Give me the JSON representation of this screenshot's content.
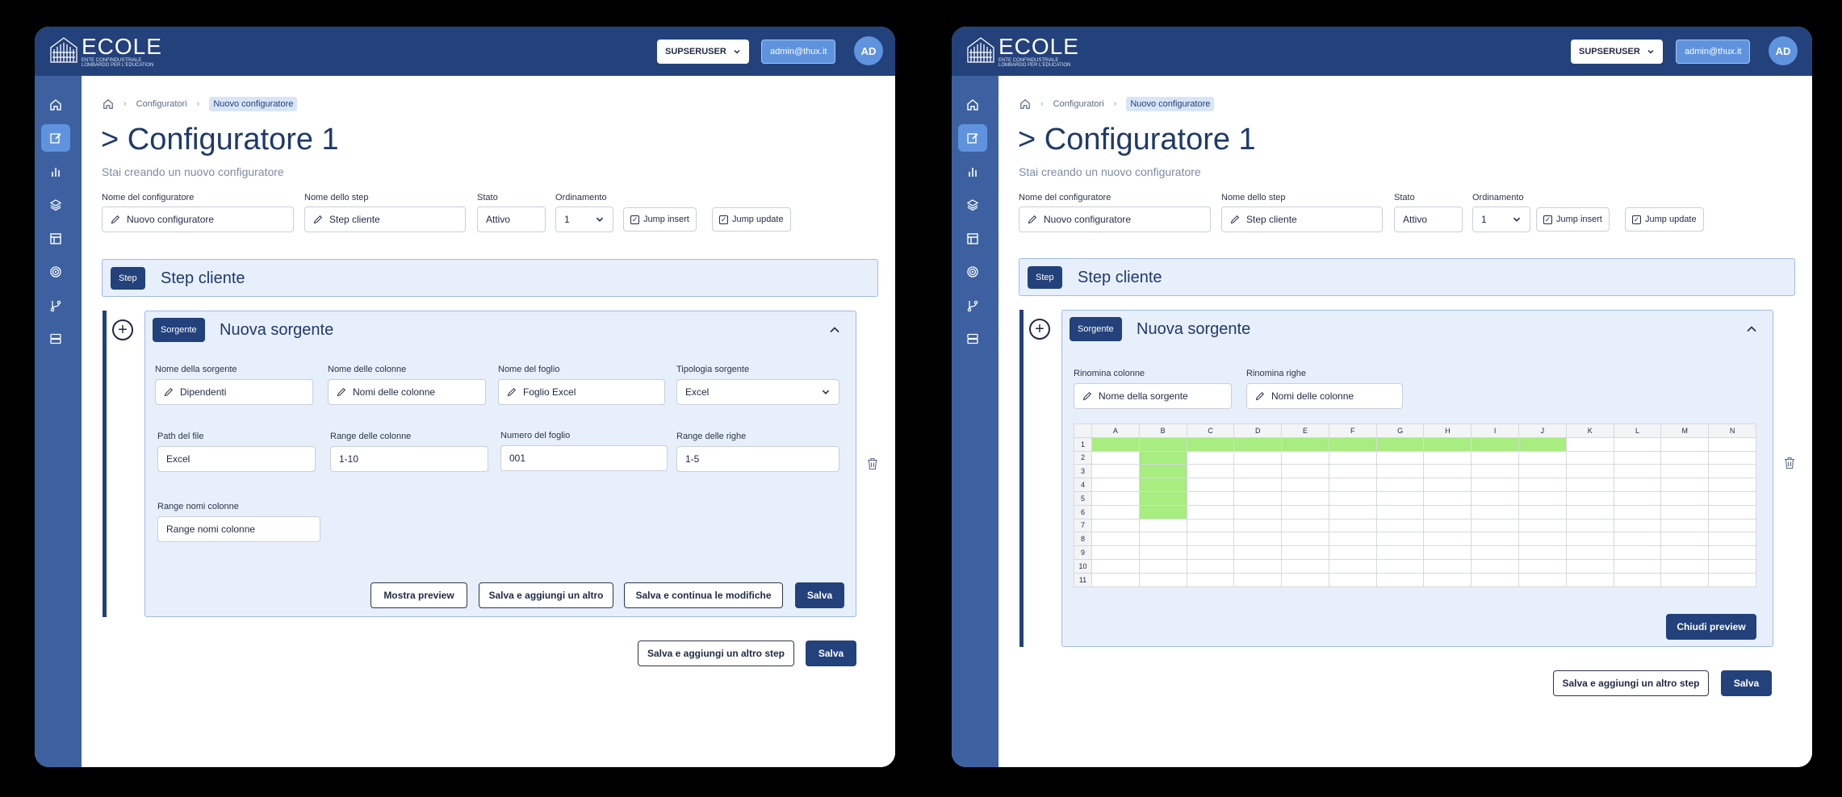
{
  "colors": {
    "topbar": "#23417a",
    "sidebar": "#3d61a0",
    "accent": "#5f93de",
    "highlight": "#a8ed7f"
  },
  "header": {
    "logo_text": "ECOLE",
    "logo_subtitle": "ENTE CONFINDUSTRIALE LOMBARDO PER L'EDUCATION",
    "role": "SUPSERUSER",
    "email": "admin@thux.it",
    "avatar": "AD"
  },
  "sidebar": {
    "items": [
      {
        "icon": "home-icon",
        "active": false
      },
      {
        "icon": "edit-icon",
        "active": true
      },
      {
        "icon": "bar-chart-icon",
        "active": false
      },
      {
        "icon": "layers-icon",
        "active": false
      },
      {
        "icon": "layout-icon",
        "active": false
      },
      {
        "icon": "target-icon",
        "active": false
      },
      {
        "icon": "git-branch-icon",
        "active": false
      },
      {
        "icon": "server-icon",
        "active": false
      }
    ]
  },
  "breadcrumb": {
    "items": [
      "Configuratori",
      "Nuovo configuratore"
    ]
  },
  "page": {
    "title": "> Configuratore 1",
    "subtitle": "Stai creando un nuovo configuratore"
  },
  "form": {
    "name_label": "Nome del configuratore",
    "name_value": "Nuovo configuratore",
    "step_label": "Nome dello step",
    "step_value": "Step cliente",
    "status_label": "Stato",
    "status_value": "Attivo",
    "order_label": "Ordinamento",
    "order_value": "1",
    "jump_insert": "Jump insert",
    "jump_update": "Jump update"
  },
  "step": {
    "badge": "Step",
    "title": "Step cliente"
  },
  "source": {
    "badge": "Sorgente",
    "title": "Nuova sorgente"
  },
  "left_form": {
    "src_name_label": "Nome della sorgente",
    "src_name_value": "Dipendenti",
    "col_names_label": "Nome delle colonne",
    "col_names_value": "Nomi delle colonne",
    "sheet_name_label": "Nome del foglio",
    "sheet_name_value": "Foglio Excel",
    "src_type_label": "Tipologia sorgente",
    "src_type_value": "Excel",
    "path_label": "Path del file",
    "path_value": "Excel",
    "col_range_label": "Range delle colonne",
    "col_range_value": "1-10",
    "sheet_num_label": "Numero del foglio",
    "sheet_num_value": "001",
    "row_range_label": "Range delle righe",
    "row_range_value": "1-5",
    "col_names_range_label": "Range nomi colonne",
    "col_names_range_value": "Range nomi colonne"
  },
  "left_buttons": {
    "preview": "Mostra preview",
    "save_add": "Salva e aggiungi un altro",
    "save_continue": "Salva e continua le modifiche",
    "save": "Salva"
  },
  "right_form": {
    "rename_cols_label": "Rinomina colonne",
    "rename_cols_value": "Nome della sorgente",
    "rename_rows_label": "Rinomina righe",
    "rename_rows_value": "Nomi delle colonne"
  },
  "spreadsheet": {
    "columns": [
      "A",
      "B",
      "C",
      "D",
      "E",
      "F",
      "G",
      "H",
      "I",
      "J",
      "K",
      "L",
      "M",
      "N"
    ],
    "rows": [
      "1",
      "2",
      "3",
      "4",
      "5",
      "6",
      "7",
      "8",
      "9",
      "10",
      "11"
    ],
    "highlight_row": 1,
    "highlight_row_columns": 10,
    "highlight_col": "B",
    "highlight_col_rows": [
      2,
      6
    ]
  },
  "preview_close": "Chiudi preview",
  "footer": {
    "save_add_step": "Salva e aggiungi un altro step",
    "save": "Salva"
  }
}
